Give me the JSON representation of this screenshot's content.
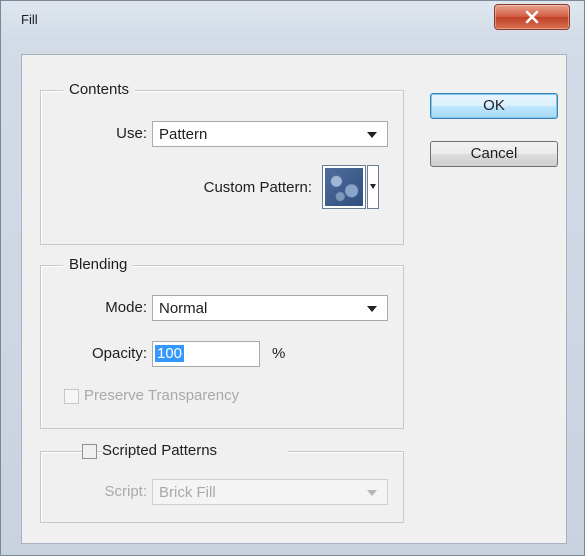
{
  "window": {
    "title": "Fill"
  },
  "contents": {
    "legend": "Contents",
    "use_label": "Use:",
    "use_value": "Pattern",
    "custom_pattern_label": "Custom Pattern:"
  },
  "blending": {
    "legend": "Blending",
    "mode_label": "Mode:",
    "mode_value": "Normal",
    "opacity_label": "Opacity:",
    "opacity_value": "100",
    "opacity_unit": "%",
    "preserve_label": "Preserve Transparency",
    "preserve_checked": false
  },
  "scripted": {
    "label": "Scripted Patterns",
    "checked": false,
    "script_label": "Script:",
    "script_value": "Brick Fill"
  },
  "buttons": {
    "ok": "OK",
    "cancel": "Cancel"
  },
  "icons": [
    "close-icon",
    "dropdown-arrow-icon",
    "pattern-swatch-icon"
  ]
}
